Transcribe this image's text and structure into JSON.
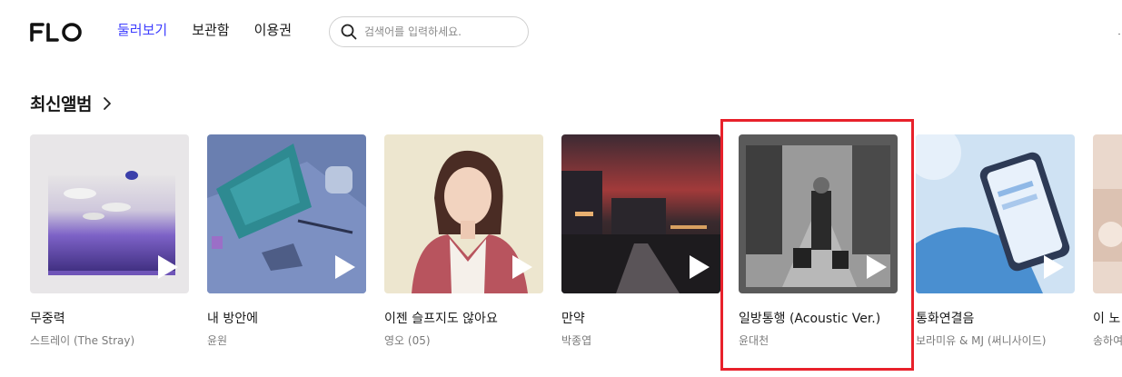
{
  "header": {
    "logo_text": "FLO",
    "nav": [
      "둘러보기",
      "보관함",
      "이용권"
    ],
    "search_placeholder": "검색어를 입력하세요."
  },
  "section": {
    "title": "최신앨범"
  },
  "albums": [
    {
      "title": "무중력",
      "artist": "스트레이 (The Stray)"
    },
    {
      "title": "내 방안에",
      "artist": "윤원"
    },
    {
      "title": "이젠 슬프지도 않아요",
      "artist": "영오 (05)"
    },
    {
      "title": "만약",
      "artist": "박종엽"
    },
    {
      "title": "일방통행 (Acoustic Ver.)",
      "artist": "윤대천"
    },
    {
      "title": "통화연결음",
      "artist": "보라미유 & MJ (써니사이드)"
    },
    {
      "title": "이 노",
      "artist": "송하여"
    }
  ],
  "colors": {
    "accent": "#3f3fff",
    "highlight": "#e8212b"
  },
  "icons": {
    "search": "search-icon",
    "chevron": "chevron-right-icon",
    "play": "play-icon"
  }
}
